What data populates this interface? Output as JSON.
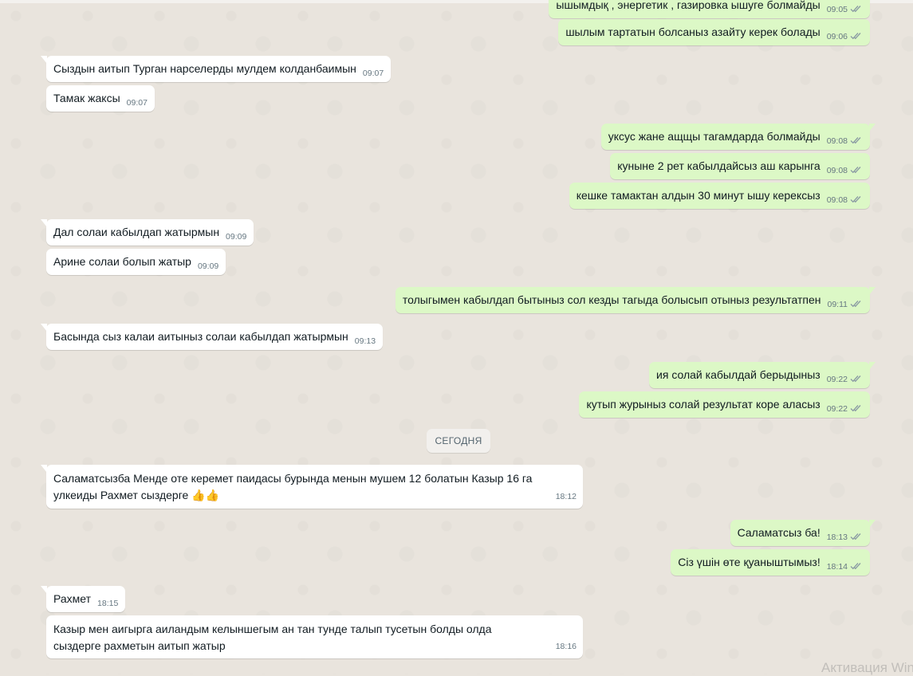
{
  "messages": [
    {
      "dir": "out",
      "text": "ышымдық , энергетик , газировка ышуге болмайды",
      "time": "09:05"
    },
    {
      "dir": "out",
      "text": "шылым тартатын болсаныз азайту керек болады",
      "time": "09:06"
    },
    {
      "dir": "in",
      "text": "Сыздын аитып Турган нарселерды мулдем колданбаимын",
      "time": "09:07"
    },
    {
      "dir": "in",
      "text": "Тамак жаксы",
      "time": "09:07"
    },
    {
      "dir": "out",
      "text": "уксус жане ащщы тагамдарда болмайды",
      "time": "09:08"
    },
    {
      "dir": "out",
      "text": "куныне 2 рет кабылдайсыз аш карынга",
      "time": "09:08"
    },
    {
      "dir": "out",
      "text": "кешке тамактан алдын 30 минут ышу керексыз",
      "time": "09:08"
    },
    {
      "dir": "in",
      "text": "Дал солаи кабылдап жатырмын",
      "time": "09:09"
    },
    {
      "dir": "in",
      "text": "Арине солаи болып жатыр",
      "time": "09:09"
    },
    {
      "dir": "out",
      "text": "толыгымен кабылдап бытыныз сол кезды тагыда болысып отыныз результатпен",
      "time": "09:11"
    },
    {
      "dir": "in",
      "text": "Басында сыз калаи аитыныз солаи кабылдап жатырмын",
      "time": "09:13"
    },
    {
      "dir": "out",
      "text": "ия солай кабылдай берыдыныз",
      "time": "09:22"
    },
    {
      "dir": "out",
      "text": "кутып журыныз солай результат коре аласыз",
      "time": "09:22"
    },
    {
      "dir": "in",
      "text": "Саламатсызба Менде оте керемет паидасы бурында менын мушем 12 болатын Казыр 16 га улкеиды Рахмет сыздерге",
      "emoji": "👍👍",
      "time": "18:12"
    },
    {
      "dir": "out",
      "text": "Саламатсыз ба!",
      "time": "18:13"
    },
    {
      "dir": "out",
      "text": "Сіз үшін өте қуаныштымыз!",
      "time": "18:14"
    },
    {
      "dir": "in",
      "text": "Рахмет",
      "time": "18:15"
    },
    {
      "dir": "in",
      "text": "Казыр мен аигырга аиландым келыншегым ан тан тунде талып тусетын болды олда сыздерге рахметын аитып жатыр",
      "time": "18:16"
    }
  ],
  "day_separator": "СЕГОДНЯ",
  "watermark": "Активация Win",
  "colors": {
    "incoming": "#ffffff",
    "outgoing": "#dcf8c6",
    "tick": "#8a9aa3"
  }
}
